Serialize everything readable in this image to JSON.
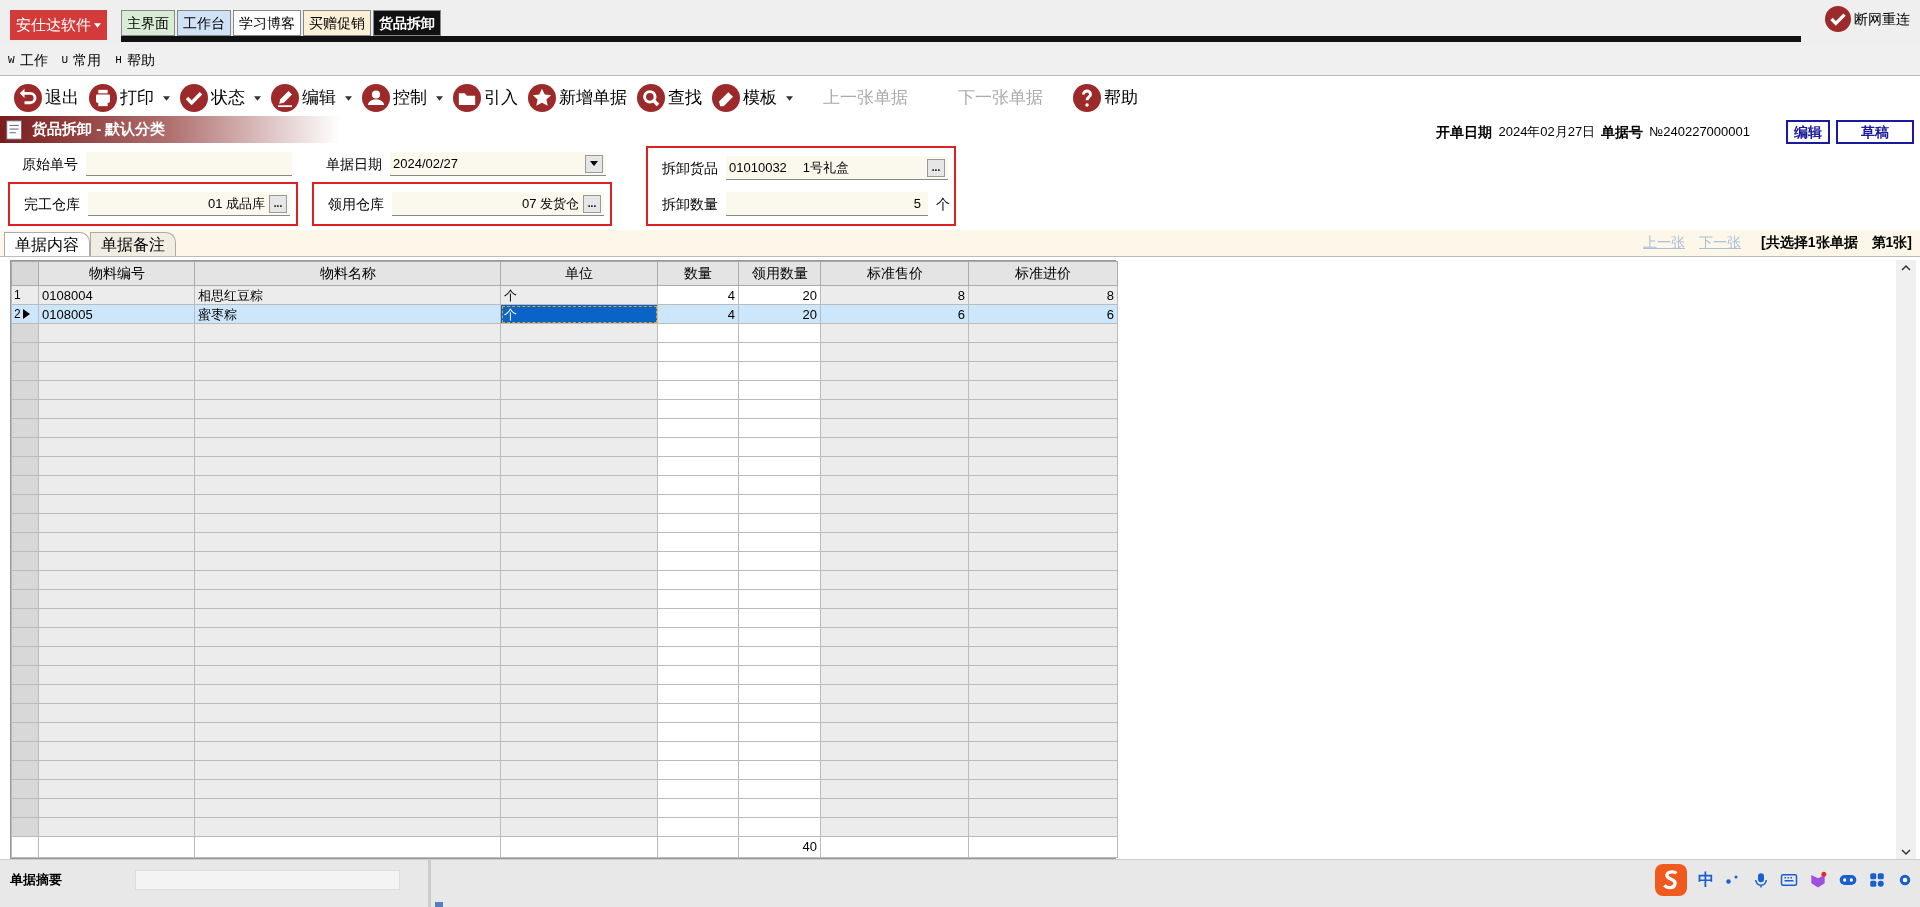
{
  "brand_menu": "安仕达软件",
  "tabs": [
    {
      "label": "主界面",
      "selected": false,
      "color": "#d8ecd6"
    },
    {
      "label": "工作台",
      "selected": false,
      "color": "#cfe2f6"
    },
    {
      "label": "学习博客",
      "selected": false,
      "color": "#ffffff"
    },
    {
      "label": "买赠促销",
      "selected": false,
      "color": "#fbf0d6"
    },
    {
      "label": "货品拆卸",
      "selected": true,
      "color": "#111111"
    }
  ],
  "connection": "断网重连",
  "menu": [
    {
      "key": "W",
      "label": "工作"
    },
    {
      "key": "U",
      "label": "常用"
    },
    {
      "key": "H",
      "label": "帮助"
    }
  ],
  "toolbar": [
    {
      "label": "退出",
      "kind": "exit",
      "dropdown": false,
      "disabled": false
    },
    {
      "label": "打印",
      "kind": "print",
      "dropdown": true,
      "disabled": false
    },
    {
      "label": "状态",
      "kind": "status",
      "dropdown": true,
      "disabled": false
    },
    {
      "label": "编辑",
      "kind": "edit",
      "dropdown": true,
      "disabled": false
    },
    {
      "label": "控制",
      "kind": "control",
      "dropdown": true,
      "disabled": false
    },
    {
      "label": "引入",
      "kind": "import",
      "dropdown": false,
      "disabled": false
    },
    {
      "label": "新增单据",
      "kind": "new",
      "dropdown": false,
      "disabled": false
    },
    {
      "label": "查找",
      "kind": "find",
      "dropdown": false,
      "disabled": false
    },
    {
      "label": "模板",
      "kind": "template",
      "dropdown": true,
      "disabled": false
    },
    {
      "label": "上一张单据",
      "kind": "plain",
      "dropdown": false,
      "disabled": true
    },
    {
      "label": "下一张单据",
      "kind": "plain",
      "dropdown": false,
      "disabled": true
    },
    {
      "label": "帮助",
      "kind": "help",
      "dropdown": false,
      "disabled": false
    }
  ],
  "document": {
    "title": "货品拆卸 - 默认分类",
    "open_date_label": "开单日期",
    "open_date": "2024年02月27日",
    "number_label": "单据号",
    "number": "№240227000001",
    "buttons": [
      "编辑",
      "草稿"
    ]
  },
  "form": {
    "columns": [
      {
        "fields": [
          {
            "label": "原始单号",
            "kind": "text",
            "highlighted": false
          },
          {
            "label": "完工仓库",
            "kind": "picker",
            "value": "01 成品库",
            "picker": "...",
            "highlighted": true
          }
        ]
      },
      {
        "fields": [
          {
            "label": "单据日期",
            "kind": "date",
            "value": "2024/02/27",
            "highlighted": false
          },
          {
            "label": "领用仓库",
            "kind": "picker",
            "value": "07 发货仓",
            "picker": "...",
            "highlighted": true
          }
        ]
      },
      {
        "fields": [
          {
            "label": "拆卸货品",
            "kind": "product",
            "code": "01010032",
            "value": "1号礼盒",
            "picker": "...",
            "highlighted": true
          },
          {
            "label": "拆卸数量",
            "kind": "quantity",
            "value": "5",
            "unit": "个",
            "highlighted": true
          }
        ]
      }
    ]
  },
  "detail_tabs": [
    {
      "label": "单据内容",
      "selected": true
    },
    {
      "label": "单据备注",
      "selected": false
    }
  ],
  "pager": {
    "prev": "上一张",
    "next": "下一张",
    "prev_disabled": true,
    "next_disabled": true,
    "summary": "[共选择1张单据　第1张]"
  },
  "table": {
    "columns": [
      "物料编号",
      "物料名称",
      "单位",
      "数量",
      "领用数量",
      "标准售价",
      "标准进价"
    ],
    "rows": [
      {
        "number": "1",
        "selected": false,
        "cells": [
          {
            "text": "0108004",
            "focused": false
          },
          {
            "text": "相思红豆粽",
            "focused": false
          },
          {
            "text": "个",
            "focused": false
          },
          {
            "text": "4",
            "focused": false
          },
          {
            "text": "20",
            "focused": false
          },
          {
            "text": "8",
            "focused": false
          },
          {
            "text": "8",
            "focused": false
          }
        ]
      },
      {
        "number": "2",
        "selected": true,
        "cells": [
          {
            "text": "0108005",
            "focused": false
          },
          {
            "text": "蜜枣粽",
            "focused": false
          },
          {
            "text": "个",
            "focused": true
          },
          {
            "text": "4",
            "focused": false
          },
          {
            "text": "20",
            "focused": false
          },
          {
            "text": "6",
            "focused": false
          },
          {
            "text": "6",
            "focused": false
          }
        ]
      }
    ],
    "total_quantity_used": "40"
  },
  "summary_field": {
    "label": "单据摘要"
  },
  "ime_bar": {
    "mode": "中"
  }
}
